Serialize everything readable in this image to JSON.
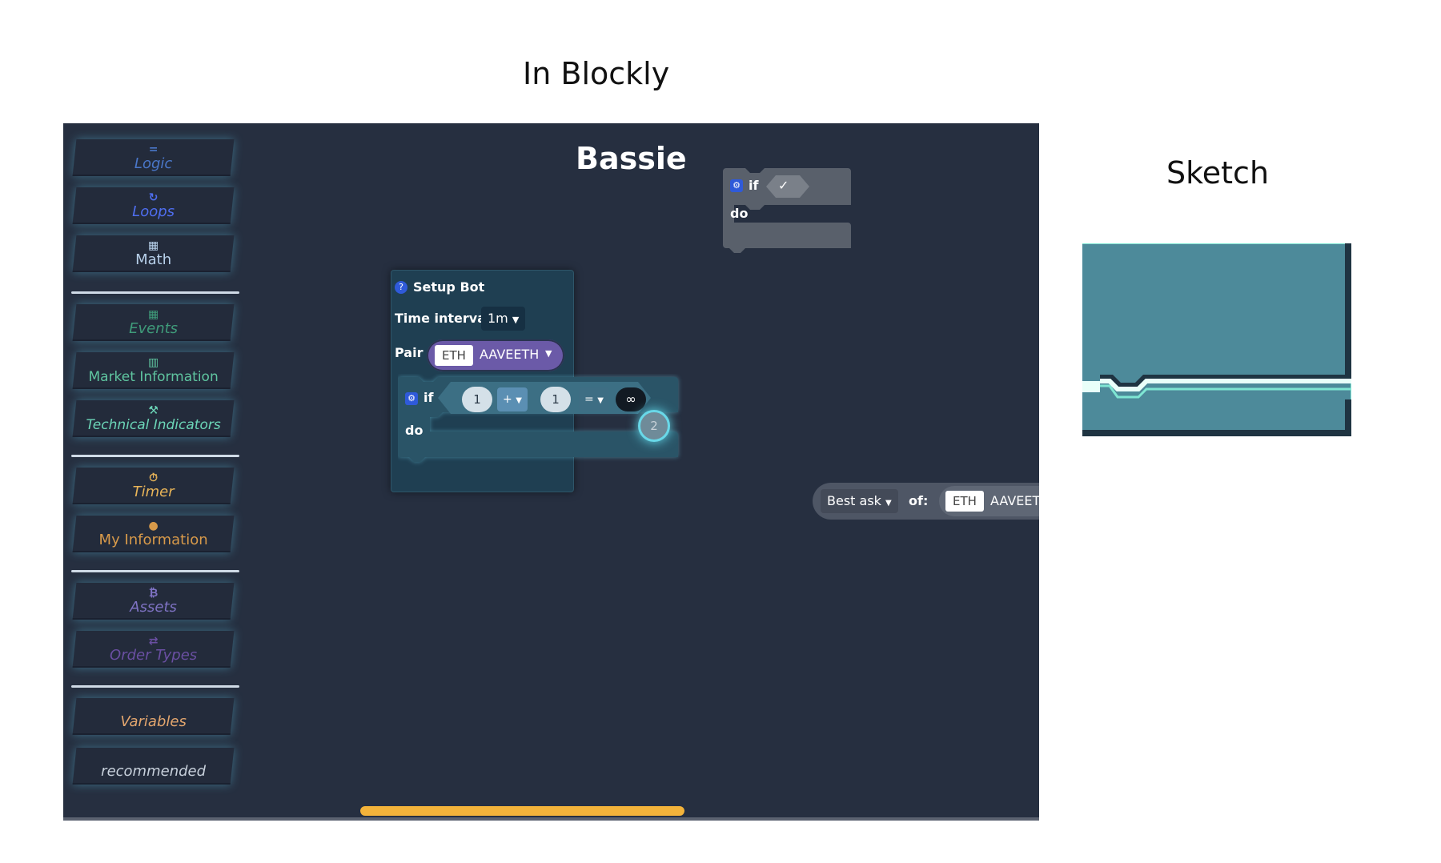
{
  "headings": {
    "blockly": "In Blockly",
    "sketch": "Sketch"
  },
  "workspace": {
    "title": "Bassie"
  },
  "sidebar": {
    "categories": [
      {
        "label": "Logic",
        "icon": "equals-icon",
        "glyph": "=",
        "color": "#4a77c9"
      },
      {
        "label": "Loops",
        "icon": "loop-arrow-icon",
        "glyph": "↻",
        "color": "#4f6ef0"
      },
      {
        "label": "Math",
        "icon": "calculator-icon",
        "glyph": "▦",
        "color": "#b7d0ea"
      },
      {
        "label": "Events",
        "icon": "calendar-icon",
        "glyph": "▦",
        "color": "#3f9b7a"
      },
      {
        "label": "Market Information",
        "icon": "bar-chart-icon",
        "glyph": "▥",
        "color": "#5fc5a0"
      },
      {
        "label": "Technical Indicators",
        "icon": "wrench-icon",
        "glyph": "⚒",
        "color": "#6cd6b8"
      },
      {
        "label": "Timer",
        "icon": "stopwatch-icon",
        "glyph": "⏱",
        "color": "#e8b458"
      },
      {
        "label": "My Information",
        "icon": "user-icon",
        "glyph": "●",
        "color": "#d89a4a"
      },
      {
        "label": "Assets",
        "icon": "bitcoin-icon",
        "glyph": "₿",
        "color": "#7f73c4"
      },
      {
        "label": "Order Types",
        "icon": "swap-arrows-icon",
        "glyph": "⇄",
        "color": "#6a4fa2"
      },
      {
        "label": "Variables",
        "icon": "",
        "glyph": "",
        "color": "#e3a66e"
      },
      {
        "label": "recommended",
        "icon": "",
        "glyph": "",
        "color": "#c8d1dc"
      }
    ]
  },
  "top_if_block": {
    "if_label": "if",
    "check": "✓",
    "do_label": "do"
  },
  "setup_block": {
    "title": "Setup Bot",
    "time_interval_label": "Time interval",
    "time_interval_value": "1m",
    "pair_label": "Pair",
    "pair_base": "ETH",
    "pair_value": "AAVEETH"
  },
  "inner_if_block": {
    "if_label": "if",
    "left_operand": "1",
    "operator": "+",
    "right_operand": "1",
    "comparison": "=",
    "compare_value": "∞",
    "result_bubble": "2",
    "do_label": "do"
  },
  "best_ask_block": {
    "field": "Best ask",
    "of_label": "of:",
    "pair_base": "ETH",
    "pair_value": "AAVEETH"
  },
  "colors": {
    "workspace_bg": "#262f40",
    "scrollbar": "#f3b33a",
    "setup_block": "#1f3f52",
    "sketch_fill": "#4d8a9a",
    "sketch_border": "#1f3442",
    "sketch_glow": "#7fe6d3"
  }
}
